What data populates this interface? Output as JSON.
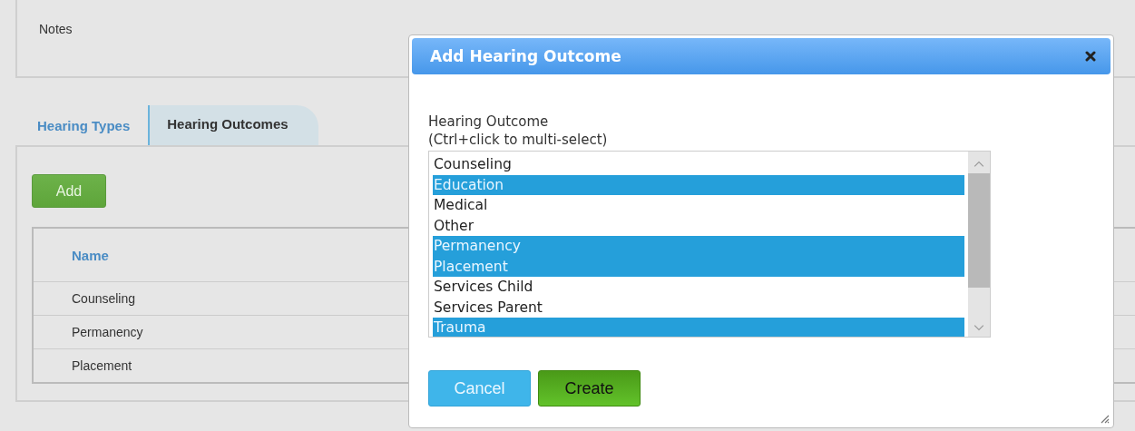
{
  "notes": {
    "label": "Notes"
  },
  "tabs": [
    {
      "label": "Hearing Types",
      "selected": false
    },
    {
      "label": "Hearing Outcomes",
      "selected": true
    }
  ],
  "add_button": "Add",
  "table": {
    "columns": [
      "Name"
    ],
    "rows": [
      [
        "Counseling"
      ],
      [
        "Permanency"
      ],
      [
        "Placement"
      ]
    ]
  },
  "dialog": {
    "title": "Add Hearing Outcome",
    "field_label": "Hearing Outcome",
    "hint": "(Ctrl+click to multi-select)",
    "options": [
      {
        "label": "Counseling",
        "selected": false
      },
      {
        "label": "Education",
        "selected": true
      },
      {
        "label": "Medical",
        "selected": false
      },
      {
        "label": "Other",
        "selected": false
      },
      {
        "label": "Permanency",
        "selected": true
      },
      {
        "label": "Placement",
        "selected": true
      },
      {
        "label": "Services Child",
        "selected": false
      },
      {
        "label": "Services Parent",
        "selected": false
      },
      {
        "label": "Trauma",
        "selected": true
      }
    ],
    "buttons": [
      {
        "label": "Cancel",
        "kind": "secondary"
      },
      {
        "label": "Create",
        "kind": "primary"
      }
    ]
  }
}
